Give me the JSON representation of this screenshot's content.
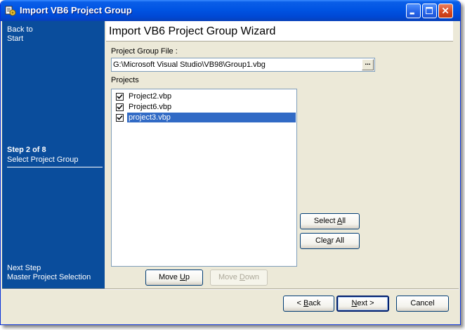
{
  "window": {
    "title": "Import VB6 Project Group",
    "app_icon": "vb-project-icon",
    "controls": [
      "minimize-icon",
      "maximize-icon",
      "close-icon"
    ]
  },
  "sidebar": {
    "back_line1": "Back to",
    "back_line2": "Start",
    "step_title": "Step 2 of 8",
    "step_name": "Select Project Group",
    "next_label": "Next Step",
    "next_name": "Master Project Selection"
  },
  "header": {
    "title": "Import VB6 Project Group Wizard"
  },
  "form": {
    "group_file_label": "Project Group File :",
    "group_file_value": "G:\\Microsoft Visual Studio\\VB98\\Group1.vbg",
    "browse_label": "...",
    "projects_label": "Projects",
    "projects": [
      {
        "name": "Project2.vbp",
        "checked": true,
        "selected": false
      },
      {
        "name": "Project6.vbp",
        "checked": true,
        "selected": false
      },
      {
        "name": "project3.vbp",
        "checked": true,
        "selected": true
      }
    ]
  },
  "buttons": {
    "select_all_pre": "Select ",
    "select_all_key": "A",
    "select_all_post": "ll",
    "clear_all_pre": "Cle",
    "clear_all_key": "a",
    "clear_all_post": "r All",
    "move_up_pre": "Move ",
    "move_up_key": "U",
    "move_up_post": "p",
    "move_down_pre": "Move ",
    "move_down_key": "D",
    "move_down_post": "own",
    "back_pre": "< ",
    "back_key": "B",
    "back_post": "ack",
    "next_pre": "",
    "next_key": "N",
    "next_post": "ext >",
    "cancel": "Cancel"
  },
  "colors": {
    "sidebar_bg": "#0A4D9C",
    "titlebar": "#0054E3",
    "dialog_bg": "#ECE9D8",
    "selection": "#316AC5"
  }
}
